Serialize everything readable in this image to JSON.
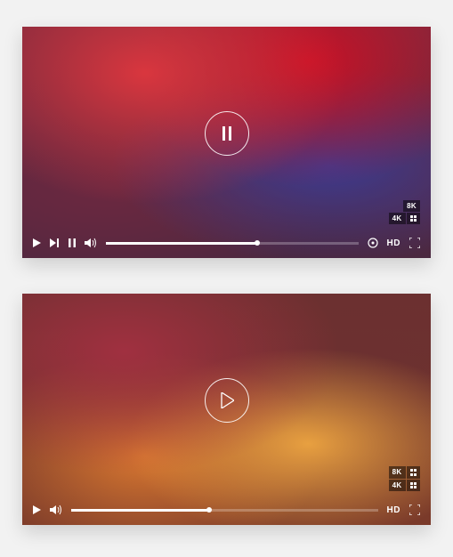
{
  "players": [
    {
      "state": "playing",
      "progress_pct": 60,
      "quality_options": [
        "8K",
        "4K"
      ],
      "hd_label": "HD"
    },
    {
      "state": "paused",
      "progress_pct": 45,
      "quality_options": [
        "8K",
        "4K"
      ],
      "hd_label": "HD"
    }
  ]
}
